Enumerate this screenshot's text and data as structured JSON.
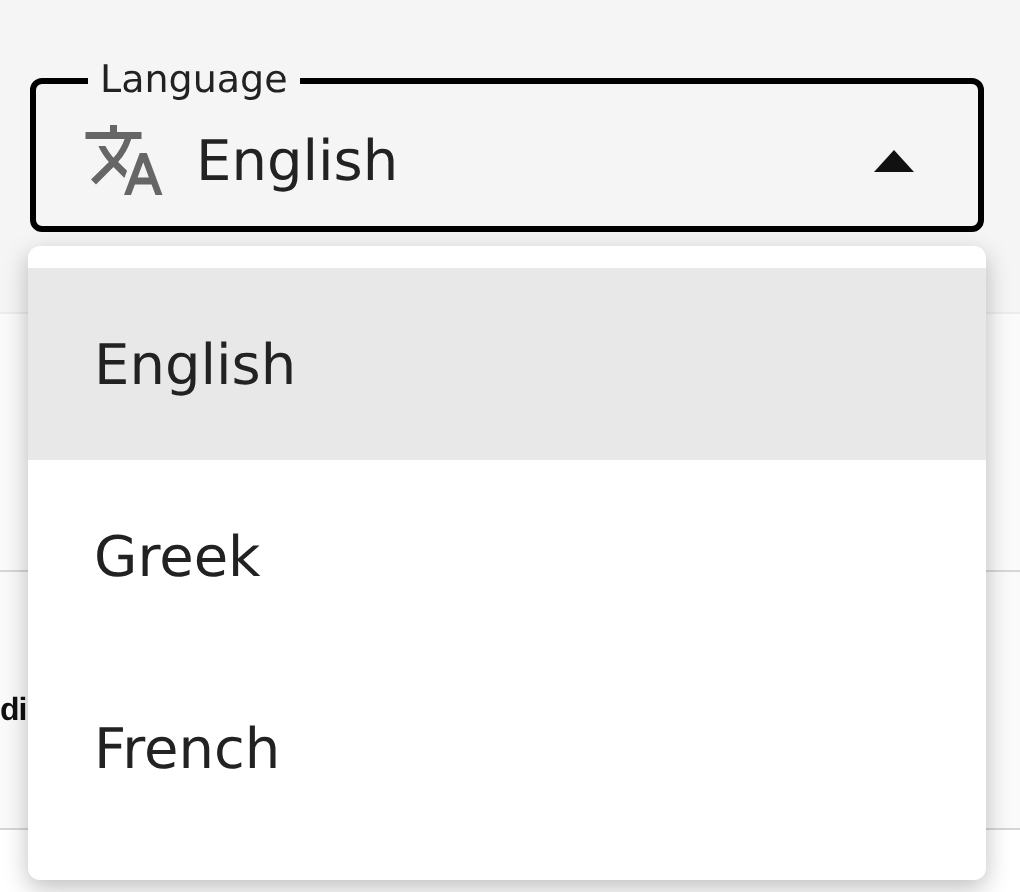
{
  "language_select": {
    "label": "Language",
    "value": "English",
    "expanded": true,
    "options": [
      {
        "label": "English",
        "selected": true
      },
      {
        "label": "Greek",
        "selected": false
      },
      {
        "label": "French",
        "selected": false
      }
    ]
  },
  "background_row_label": "di"
}
